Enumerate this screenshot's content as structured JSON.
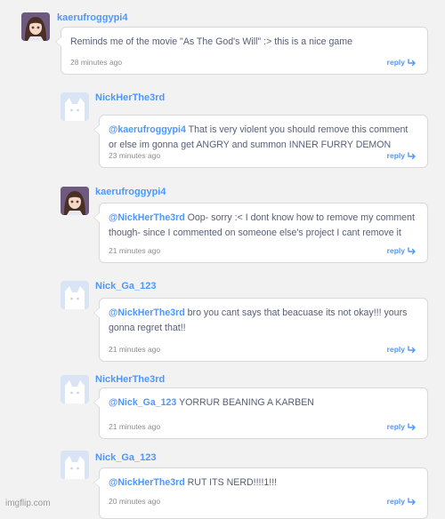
{
  "comments": [
    {
      "username": "kaerufroggypi4",
      "mention": "",
      "body": "Reminds me of the movie \"As The God's Will\" :> this is a nice game",
      "time": "28 minutes ago",
      "avatar": "girl-avatar-icon",
      "reply_label": "reply"
    },
    {
      "username": "NickHerThe3rd",
      "mention": "@kaerufroggypi4",
      "body": "That is very violent you should remove this comment or else im gonna get ANGRY and summon INNER FURRY DEMON",
      "time": "23 minutes ago",
      "avatar": "default-cat-avatar-icon",
      "reply_label": "reply"
    },
    {
      "username": "kaerufroggypi4",
      "mention": "@NickHerThe3rd",
      "body": "Oop- sorry :< I dont know how to remove my comment though- since I commented on someone else's project I cant remove it",
      "time": "21 minutes ago",
      "avatar": "girl-avatar-icon",
      "reply_label": "reply"
    },
    {
      "username": "Nick_Ga_123",
      "mention": "@NickHerThe3rd",
      "body": "bro you cant says that beacuase its not okay!!! yours gonna regret that!!",
      "time": "21 minutes ago",
      "avatar": "default-cat-avatar-icon",
      "reply_label": "reply"
    },
    {
      "username": "NickHerThe3rd",
      "mention": "@Nick_Ga_123",
      "body": "YORRUR BEANING A KARBEN",
      "time": "21 minutes ago",
      "avatar": "default-cat-avatar-icon",
      "reply_label": "reply"
    },
    {
      "username": "Nick_Ga_123",
      "mention": "@NickHerThe3rd",
      "body": "RUT ITS NERD!!!!1!!!",
      "time": "20 minutes ago",
      "avatar": "default-cat-avatar-icon",
      "reply_label": "reply"
    }
  ],
  "watermark": "imgflip.com",
  "colors": {
    "link": "#4d97ff",
    "text": "#575e75",
    "muted": "#8c8c8c",
    "background": "#f2f2f2"
  }
}
